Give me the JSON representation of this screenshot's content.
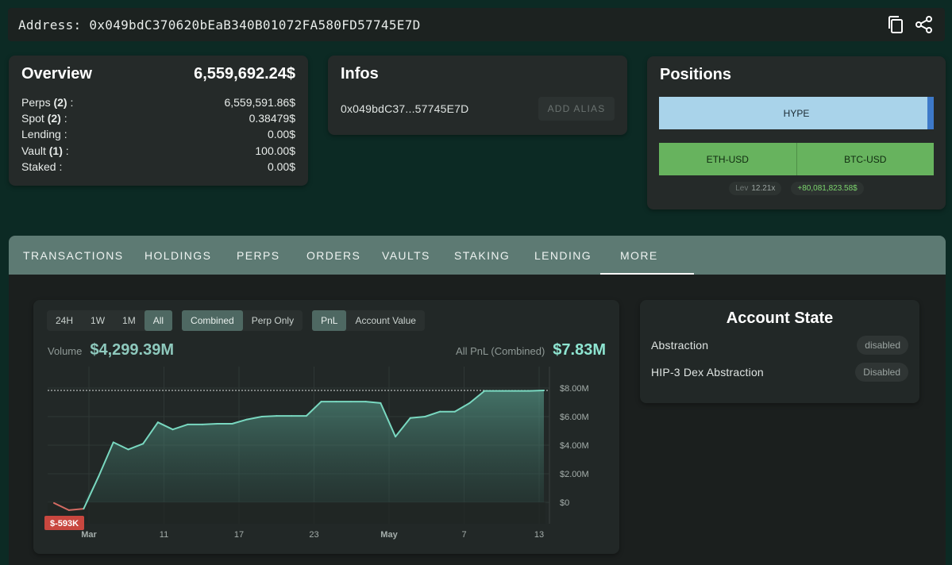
{
  "address_bar": {
    "label": "Address: 0x049bdC370620bEaB340B01072FA580FD57745E7D",
    "copy_icon": "copy-icon",
    "share_icon": "share-icon"
  },
  "overview": {
    "title": "Overview",
    "total": "6,559,692.24$",
    "rows": [
      {
        "label": "Perps",
        "count": "(2)",
        "suffix": " :",
        "value": "6,559,591.86$"
      },
      {
        "label": "Spot",
        "count": "(2)",
        "suffix": " :",
        "value": "0.38479$"
      },
      {
        "label": "Lending",
        "count": "",
        "suffix": " :",
        "value": "0.00$"
      },
      {
        "label": "Vault",
        "count": "(1)",
        "suffix": " :",
        "value": "100.00$"
      },
      {
        "label": "Staked",
        "count": "",
        "suffix": " :",
        "value": "0.00$"
      }
    ]
  },
  "infos": {
    "title": "Infos",
    "short_address": "0x049bdC37...57745E7D",
    "add_alias_label": "ADD ALIAS"
  },
  "positions": {
    "title": "Positions",
    "hype_label": "HYPE",
    "perp_positions": [
      "ETH-USD",
      "BTC-USD"
    ],
    "lev_label": "Lev",
    "lev_value": "12.21x",
    "pnl_value": "+80,081,823.58$",
    "colors": {
      "spot": "#a9d3ea",
      "long": "#67b35e",
      "profit": "#7bd36c"
    }
  },
  "tabs": [
    "TRANSACTIONS",
    "HOLDINGS",
    "PERPS",
    "ORDERS",
    "VAULTS",
    "STAKING",
    "LENDING",
    "MORE"
  ],
  "active_tab": "MORE",
  "chart_panel": {
    "range_buttons": [
      "24H",
      "1W",
      "1M",
      "All"
    ],
    "range_selected": "All",
    "mode_buttons": [
      "Combined",
      "Perp Only"
    ],
    "mode_selected": "Combined",
    "metric_buttons": [
      "PnL",
      "Account Value"
    ],
    "metric_selected": "PnL",
    "volume_label": "Volume",
    "volume_value": "$4,299.39M",
    "pnl_label": "All PnL (Combined)",
    "pnl_value": "$7.83M",
    "min_marker": "$-593K"
  },
  "chart_data": {
    "type": "area",
    "title": "",
    "xlabel": "",
    "ylabel": "",
    "x_tick_labels": [
      "Mar",
      "11",
      "17",
      "23",
      "May",
      "7",
      "13"
    ],
    "y_tick_labels": [
      "$8.00M",
      "$6.00M",
      "$4.00M",
      "$2.00M",
      "$0"
    ],
    "ylim": [
      -1.5,
      9.5
    ],
    "units": "$M",
    "reference_line": 7.83,
    "series": [
      {
        "values": [
          -0.05,
          -0.55,
          -0.45,
          1.8,
          4.2,
          3.7,
          4.1,
          5.6,
          5.1,
          5.45,
          5.45,
          5.5,
          5.5,
          5.8,
          6.0,
          6.05,
          6.05,
          6.05,
          7.05,
          7.05,
          7.05,
          7.05,
          6.95,
          4.6,
          5.9,
          6.0,
          6.35,
          6.35,
          6.95,
          7.8,
          7.8,
          7.8,
          7.8,
          7.83
        ]
      }
    ],
    "colors": {
      "positive": "#79d8c0",
      "negative": "#d46b63"
    }
  },
  "account_state": {
    "title": "Account State",
    "rows": [
      {
        "label": "Abstraction",
        "value": "disabled"
      },
      {
        "label": "HIP-3 Dex Abstraction",
        "value": "Disabled"
      }
    ]
  }
}
